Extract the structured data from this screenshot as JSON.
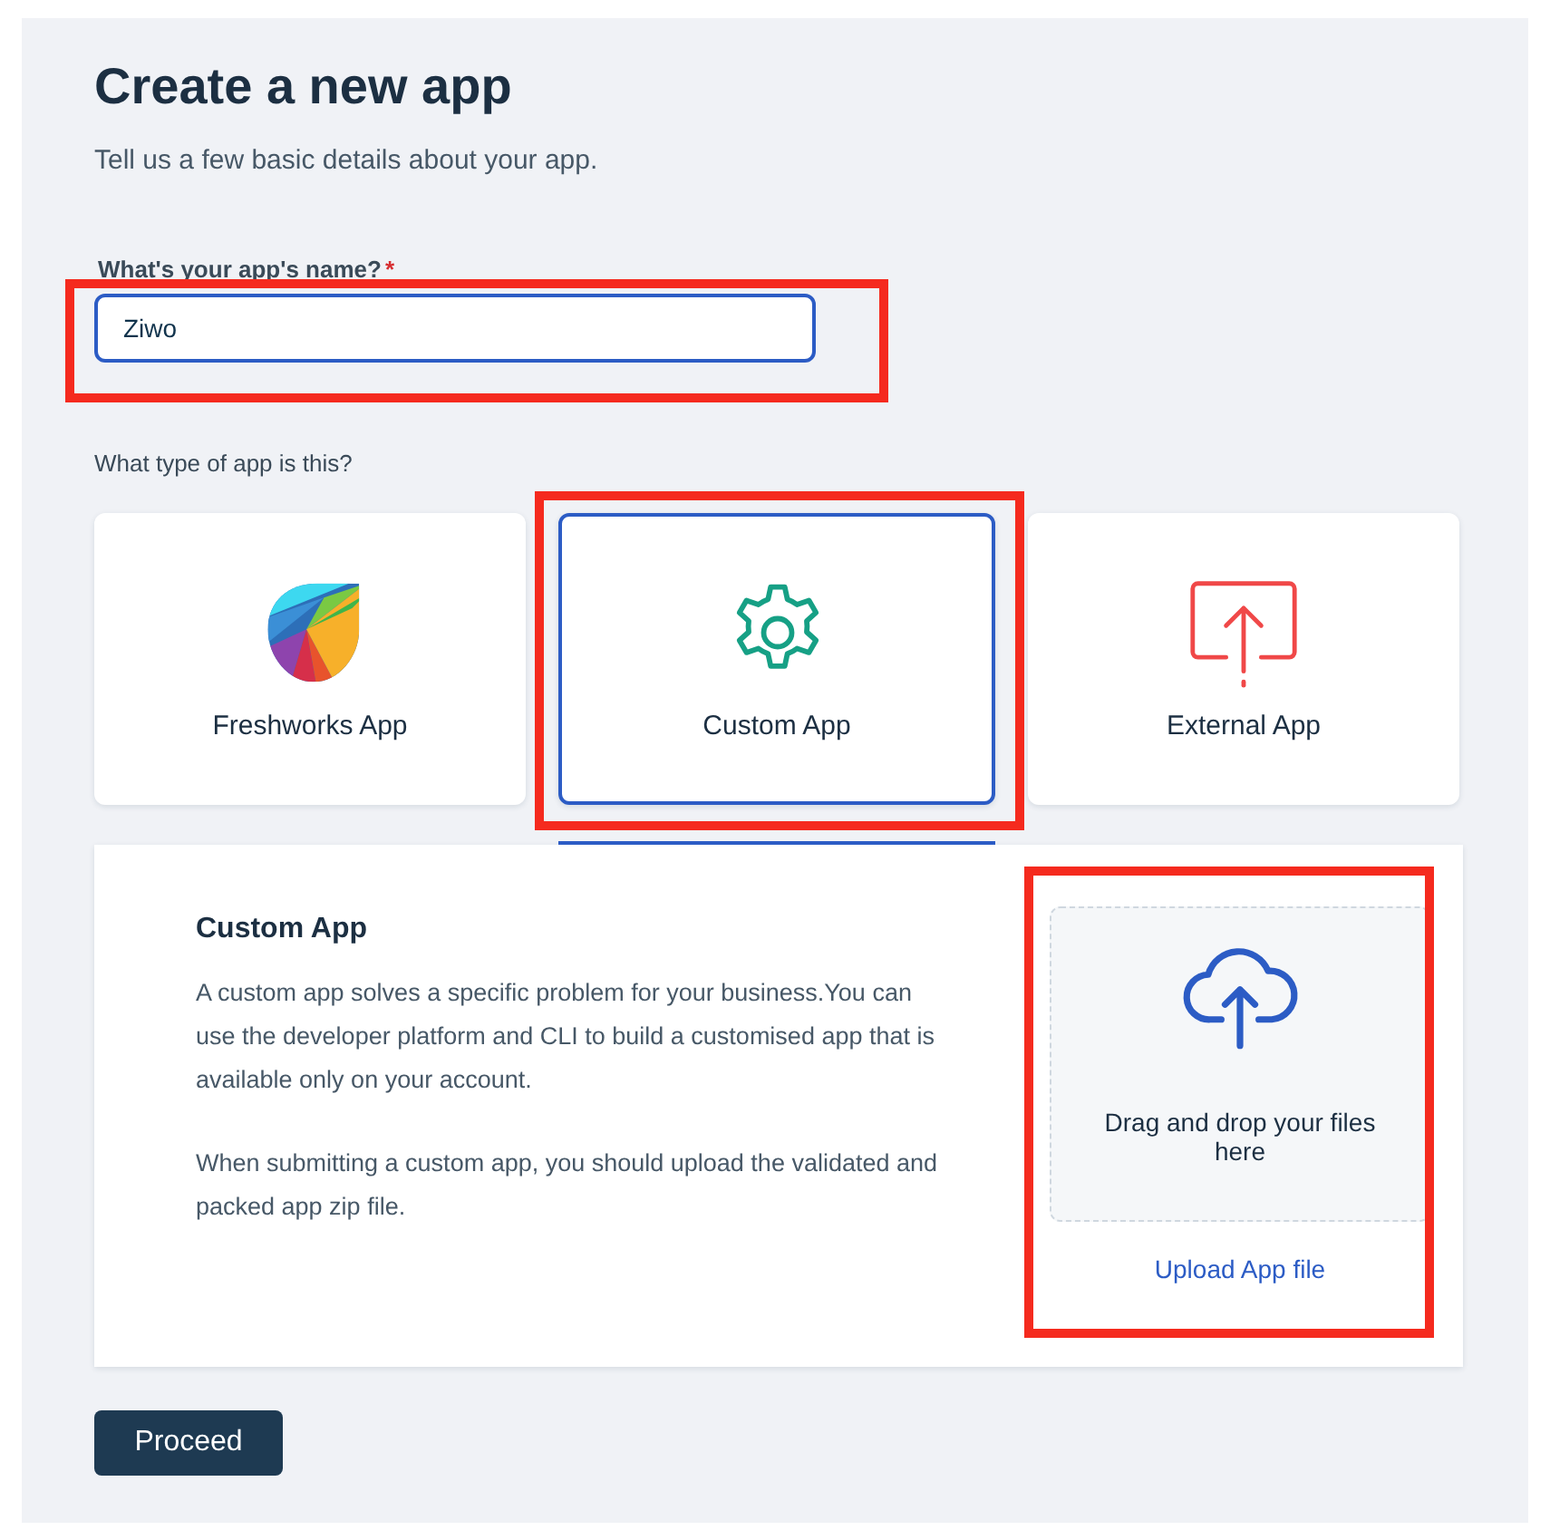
{
  "page": {
    "title": "Create a new app",
    "subtitle": "Tell us a few basic details about your app."
  },
  "name_field": {
    "label": "What's your app's name?",
    "required_mark": "*",
    "value": "Ziwo",
    "focused": true,
    "highlighted": true
  },
  "type_question": "What type of app is this?",
  "app_types": [
    {
      "kind": "freshworks",
      "label": "Freshworks App",
      "selected": false,
      "highlighted": false
    },
    {
      "kind": "custom",
      "label": "Custom App",
      "selected": true,
      "highlighted": true
    },
    {
      "kind": "external",
      "label": "External App",
      "selected": false,
      "highlighted": false
    }
  ],
  "details": {
    "title": "Custom App",
    "paragraphs": [
      "A custom app solves a specific problem for your business.You can use the developer platform and CLI to build a customised app that is available only on your account.",
      "When submitting a custom app, you should upload the validated and packed app zip file."
    ]
  },
  "upload": {
    "prompt": "Drag and drop your files here",
    "link": "Upload App file",
    "highlighted": true
  },
  "proceed_button": "Proceed"
}
